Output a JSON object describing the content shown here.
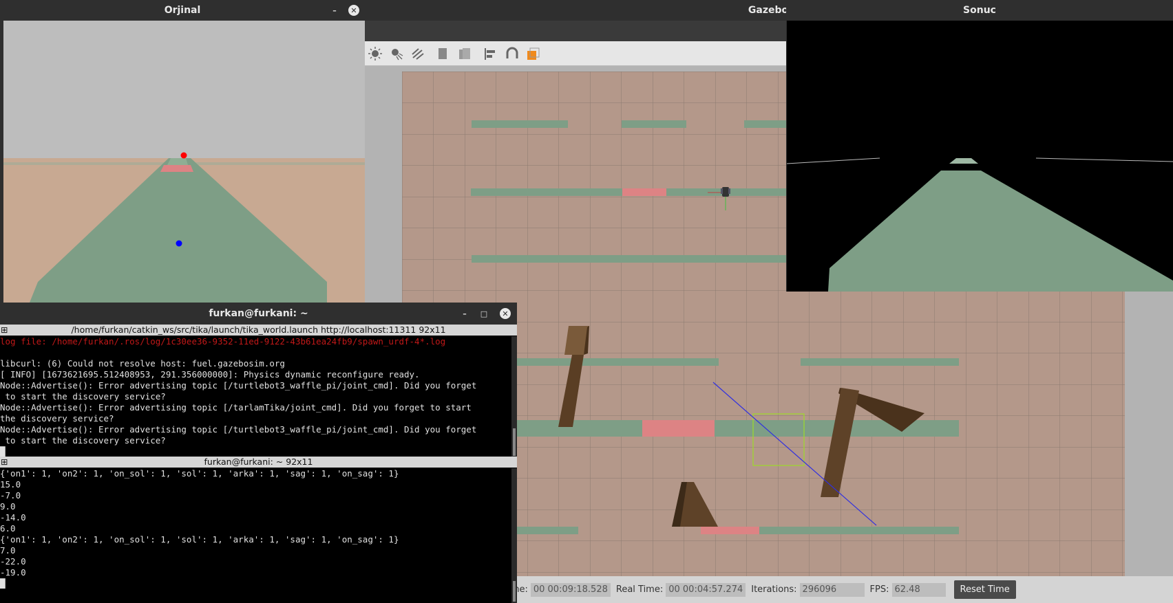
{
  "windows": {
    "orjinal": {
      "title": "Orjinal",
      "minimize": "–",
      "close": "✕"
    },
    "gazebo": {
      "title": "Gazebo"
    },
    "sonuc": {
      "title": "Sonuc"
    }
  },
  "terminal": {
    "title": "furkan@furkani: ~",
    "minimize": "–",
    "maximize": "□",
    "close": "✕",
    "pane1_header": "/home/furkan/catkin_ws/src/tika/launch/tika_world.launch http://localhost:11311 92x11",
    "pane1_lines": [
      {
        "text": "log file: /home/furkan/.ros/log/1c30ee36-9352-11ed-9122-43b61ea24fb9/spawn_urdf-4*.log",
        "color": "#c01818"
      },
      {
        "text": "",
        "color": "#e0e0e0"
      },
      {
        "text": "libcurl: (6) Could not resolve host: fuel.gazebosim.org",
        "color": "#e0e0e0"
      },
      {
        "text": "[ INFO] [1673621695.512408953, 291.356000000]: Physics dynamic reconfigure ready.",
        "color": "#e0e0e0"
      },
      {
        "text": "Node::Advertise(): Error advertising topic [/turtlebot3_waffle_pi/joint_cmd]. Did you forget",
        "color": "#e0e0e0"
      },
      {
        "text": " to start the discovery service?",
        "color": "#e0e0e0"
      },
      {
        "text": "Node::Advertise(): Error advertising topic [/tarlamTika/joint_cmd]. Did you forget to start",
        "color": "#e0e0e0"
      },
      {
        "text": "the discovery service?",
        "color": "#e0e0e0"
      },
      {
        "text": "Node::Advertise(): Error advertising topic [/turtlebot3_waffle_pi/joint_cmd]. Did you forget",
        "color": "#e0e0e0"
      },
      {
        "text": " to start the discovery service?",
        "color": "#e0e0e0"
      },
      {
        "text": "█",
        "color": "#e0e0e0"
      }
    ],
    "pane2_header": "furkan@furkani: ~ 92x11",
    "pane2_lines": [
      "{'on1': 1, 'on2': 1, 'on_sol': 1, 'sol': 1, 'arka': 1, 'sag': 1, 'on_sag': 1}",
      "15.0",
      "-7.0",
      "9.0",
      "-14.0",
      "6.0",
      "{'on1': 1, 'on2': 1, 'on_sol': 1, 'sol': 1, 'arka': 1, 'sag': 1, 'on_sag': 1}",
      "7.0",
      "-22.0",
      "-19.0",
      "█"
    ]
  },
  "status": {
    "sim_time_label": "Sim Time:",
    "sim_time_value": "00 00:09:18.528",
    "real_time_label": "Real Time:",
    "real_time_value": "00 00:04:57.274",
    "iterations_label": "Iterations:",
    "iterations_value": "296096",
    "fps_label": "FPS:",
    "fps_value": "62.48",
    "reset_label": "Reset Time"
  },
  "toolbar_icons": [
    "directional-light-icon",
    "spot-light-icon",
    "point-light-icon",
    "copy-icon",
    "paste-icon",
    "align-icon",
    "snap-icon",
    "view-angle-icon"
  ],
  "colors": {
    "ground": "#b4988a",
    "crop_row": "#7e9e86",
    "crop_row_highlight": "#dd8384",
    "terminal_bg": "#000000",
    "terminal_header": "#d6d6d6",
    "sky": "#bdbdbd",
    "field": "#c8a992",
    "red_marker": "#ff0000",
    "blue_marker": "#0000ff"
  }
}
